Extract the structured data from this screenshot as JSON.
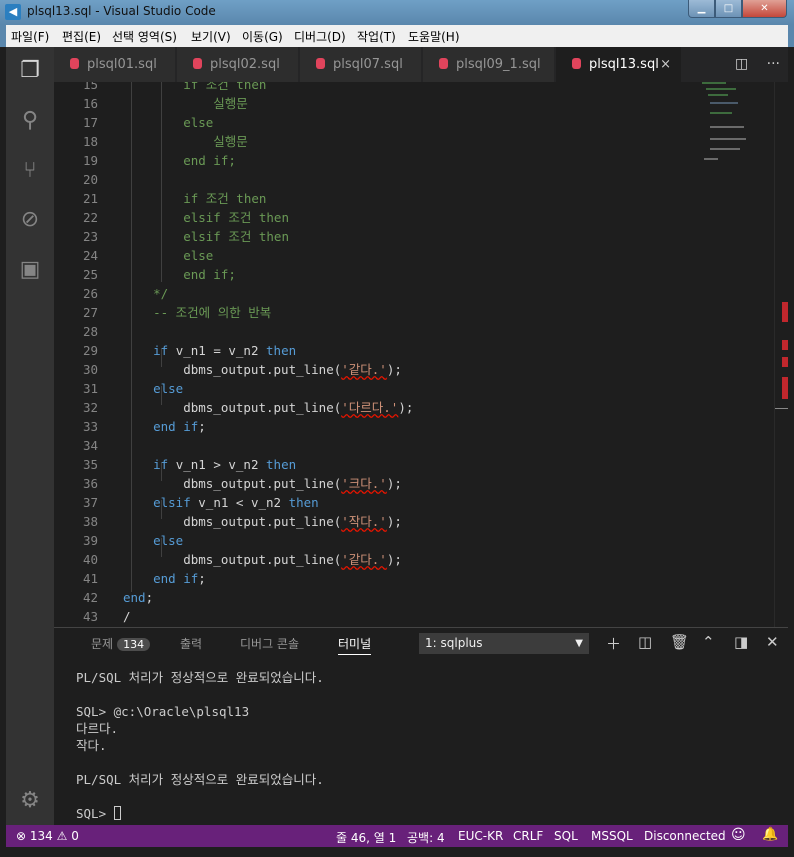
{
  "window": {
    "title": "plsql13.sql - Visual Studio Code",
    "min": "0",
    "max": "1",
    "close": "r"
  },
  "menu": [
    "파일(F)",
    "편집(E)",
    "선택 영역(S)",
    "보기(V)",
    "이동(G)",
    "디버그(D)",
    "작업(T)",
    "도움말(H)"
  ],
  "activity": [
    "explorer-icon",
    "search-icon",
    "source-control-icon",
    "debug-icon",
    "extensions-icon",
    "settings-icon"
  ],
  "tabs": [
    {
      "label": "plsql01.sql"
    },
    {
      "label": "plsql02.sql"
    },
    {
      "label": "plsql07.sql"
    },
    {
      "label": "plsql09_1.sql"
    },
    {
      "label": "plsql13.sql",
      "close": "×"
    }
  ],
  "editor_lines": [
    {
      "n": "15",
      "text": "        if 조건 then"
    },
    {
      "n": "16",
      "text": "            실행문"
    },
    {
      "n": "17",
      "text": "        else"
    },
    {
      "n": "18",
      "text": "            실행문"
    },
    {
      "n": "19",
      "text": "        end if;"
    },
    {
      "n": "20",
      "text": ""
    },
    {
      "n": "21",
      "text": "        if 조건 then"
    },
    {
      "n": "22",
      "text": "        elsif 조건 then"
    },
    {
      "n": "23",
      "text": "        elsif 조건 then"
    },
    {
      "n": "24",
      "text": "        else"
    },
    {
      "n": "25",
      "text": "        end if;"
    },
    {
      "n": "26",
      "text": "    */"
    },
    {
      "n": "27",
      "text": "    -- 조건에 의한 반복"
    },
    {
      "n": "28",
      "text": ""
    },
    {
      "n": "29",
      "text": "    if v_n1 = v_n2 then"
    },
    {
      "n": "30",
      "text": "        dbms_output.put_line('같다.');"
    },
    {
      "n": "31",
      "text": "    else"
    },
    {
      "n": "32",
      "text": "        dbms_output.put_line('다르다.');"
    },
    {
      "n": "33",
      "text": "    end if;"
    },
    {
      "n": "34",
      "text": ""
    },
    {
      "n": "35",
      "text": "    if v_n1 > v_n2 then"
    },
    {
      "n": "36",
      "text": "        dbms_output.put_line('크다.');"
    },
    {
      "n": "37",
      "text": "    elsif v_n1 < v_n2 then"
    },
    {
      "n": "38",
      "text": "        dbms_output.put_line('작다.');"
    },
    {
      "n": "39",
      "text": "    else"
    },
    {
      "n": "40",
      "text": "        dbms_output.put_line('같다.');"
    },
    {
      "n": "41",
      "text": "    end if;"
    },
    {
      "n": "42",
      "text": "end;"
    },
    {
      "n": "43",
      "text": "/"
    }
  ],
  "panel": {
    "tabs": [
      "문제",
      "출력",
      "디버그 콘솔",
      "터미널"
    ],
    "problem_count": "134",
    "terminal_select": "1: sqlplus",
    "terminal_lines": [
      "PL/SQL 처리가 정상적으로 완료되었습니다.",
      "",
      "SQL> @c:\\Oracle\\plsql13",
      "다르다.",
      "작다.",
      "",
      "PL/SQL 처리가 정상적으로 완료되었습니다.",
      "",
      "SQL> "
    ]
  },
  "status": {
    "errors": "134",
    "warnings": "0",
    "position": "줄 46, 열 1",
    "indent": "공백: 4",
    "encoding": "EUC-KR",
    "eol": "CRLF",
    "language": "SQL",
    "dialect": "MSSQL",
    "connection": "Disconnected"
  },
  "colors": {
    "statusbar": "#68217a",
    "accent_db": "#e0445c",
    "keyword": "#569cd6",
    "comment": "#6a9955",
    "string": "#ce9178"
  }
}
